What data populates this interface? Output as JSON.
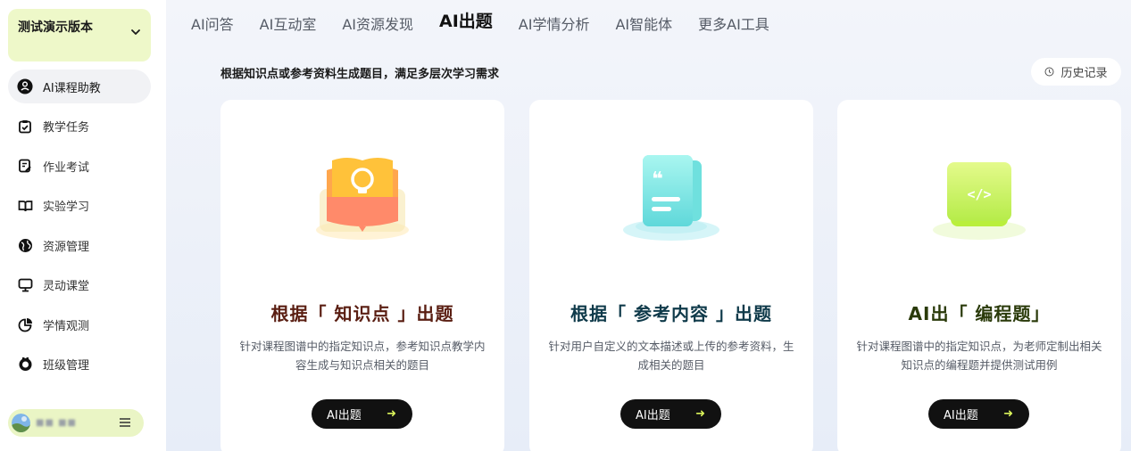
{
  "sidebar": {
    "version_title": "测试演示版本",
    "items": [
      {
        "label": "AI课程助教",
        "icon": "ai-assistant-icon",
        "active": true
      },
      {
        "label": "教学任务",
        "icon": "clipboard-check-icon",
        "active": false
      },
      {
        "label": "作业考试",
        "icon": "exam-edit-icon",
        "active": false
      },
      {
        "label": "实验学习",
        "icon": "book-open-icon",
        "active": false
      },
      {
        "label": "资源管理",
        "icon": "globe-icon",
        "active": false
      },
      {
        "label": "灵动课堂",
        "icon": "monitor-icon",
        "active": false
      },
      {
        "label": "学情观测",
        "icon": "pie-chart-icon",
        "active": false
      },
      {
        "label": "班级管理",
        "icon": "class-group-icon",
        "active": false
      }
    ],
    "user": {
      "name": "■■ ■■"
    }
  },
  "tabs": [
    {
      "label": "AI问答",
      "active": false
    },
    {
      "label": "AI互动室",
      "active": false
    },
    {
      "label": "AI资源发现",
      "active": false
    },
    {
      "label": "AI出题",
      "active": true
    },
    {
      "label": "AI学情分析",
      "active": false
    },
    {
      "label": "AI智能体",
      "active": false
    },
    {
      "label": "更多AI工具",
      "active": false
    }
  ],
  "subtitle": "根据知识点或参考资料生成题目，满足多层次学习需求",
  "history_label": "历史记录",
  "cards": [
    {
      "title": "根据「 知识点 」出题",
      "title_color": "#5a1e12",
      "desc": "针对课程图谱中的指定知识点，参考知识点教学内容生成与知识点相关的题目",
      "button": "AI出题",
      "icon": "lightbulb-book-icon"
    },
    {
      "title": "根据「 参考内容 」出题",
      "title_color": "#0f3a4a",
      "desc": "针对用户自定义的文本描述或上传的参考资料，生成相关的题目",
      "button": "AI出题",
      "icon": "quote-document-icon"
    },
    {
      "title": "AI出「 编程题」",
      "title_color": "#2a3a0a",
      "desc": "针对课程图谱中的指定知识点，为老师定制出相关知识点的编程题并提供测试用例",
      "button": "AI出题",
      "icon": "code-window-icon"
    }
  ],
  "colors": {
    "accent": "#d9f25a",
    "version_bg": "#eef8c9"
  }
}
